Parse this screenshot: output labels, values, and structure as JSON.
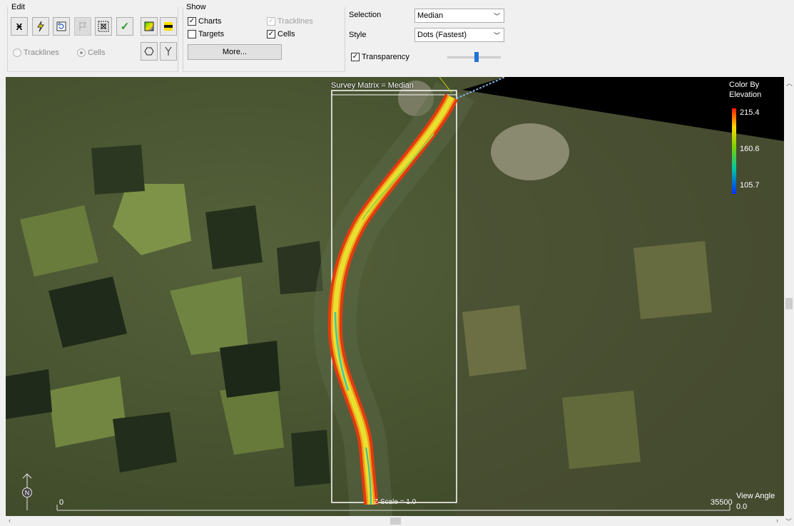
{
  "edit": {
    "title": "Edit",
    "radio_tracklines": "Tracklines",
    "radio_cells": "Cells"
  },
  "show": {
    "title": "Show",
    "charts": "Charts",
    "tracklines": "Tracklines",
    "targets": "Targets",
    "cells": "Cells",
    "more": "More..."
  },
  "options": {
    "selection_label": "Selection",
    "selection_value": "Median",
    "style_label": "Style",
    "style_value": "Dots (Fastest)",
    "transparency_label": "Transparency",
    "transparency_level": 0.55
  },
  "view": {
    "title": "Survey Matrix = Median",
    "zscale": "Z Scale = 1.0",
    "scale_start": "0",
    "scale_end": "35500",
    "angle_label": "View Angle",
    "angle_value": "0.0",
    "north": "N"
  },
  "legend": {
    "title_line1": "Color By",
    "title_line2": "Elevation",
    "max": "215.4",
    "mid": "160.6",
    "min": "105.7",
    "colors": [
      "#ff1a00",
      "#ffd800",
      "#7cd100",
      "#00c8a0",
      "#0030ff"
    ]
  }
}
